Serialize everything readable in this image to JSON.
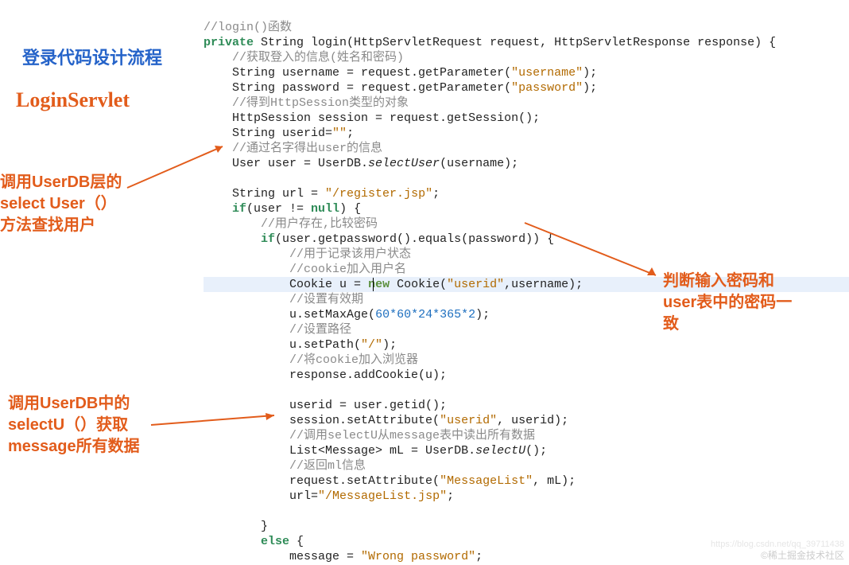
{
  "annotations": {
    "title_blue": "登录代码设计流程",
    "title_orange": "LoginServlet",
    "left1_l1": "调用UserDB层的",
    "left1_l2": "select User（）",
    "left1_l3": "方法查找用户",
    "left2_l1": "调用UserDB中的",
    "left2_l2": "selectU（）获取",
    "left2_l3": "message所有数据",
    "right_l1": "判断输入密码和",
    "right_l2": "user表中的密码一",
    "right_l3": "致"
  },
  "code": {
    "l01a": "//login()函数",
    "l02_kw": "private",
    "l02_rest": " String login(HttpServletRequest request, HttpServletResponse response) {",
    "l03": "//获取登入的信息(姓名和密码)",
    "l04a": "String username = request.getParameter(",
    "l04s": "\"username\"",
    "l04b": ");",
    "l05a": "String password = request.getParameter(",
    "l05s": "\"password\"",
    "l05b": ");",
    "l06": "//得到HttpSession类型的对象",
    "l07": "HttpSession session = request.getSession();",
    "l08a": "String userid=",
    "l08s": "\"\"",
    "l08b": ";",
    "l09": "//通过名字得出user的信息",
    "l10a": "User user = UserDB.",
    "l10i": "selectUser",
    "l10b": "(username);",
    "l11_blank": "",
    "l12a": "String url = ",
    "l12s": "\"/register.jsp\"",
    "l12b": ";",
    "l13_if": "if",
    "l13a": "(user != ",
    "l13_null": "null",
    "l13b": ") {",
    "l14": "//用户存在,比较密码",
    "l15_if": "if",
    "l15a": "(user.getpassword().equals(password)) {",
    "l16": "//用于记录该用户状态",
    "l17": "//cookie加入用户名",
    "l18a": "Cookie u = ",
    "l18_new": "new",
    "l18b": " Cookie(",
    "l18s": "\"userid\"",
    "l18c": ",username);",
    "l19": "//设置有效期",
    "l20a": "u.setMaxAge(",
    "l20n": "60*60*24*365*2",
    "l20b": ");",
    "l21": "//设置路径",
    "l22a": "u.setPath(",
    "l22s": "\"/\"",
    "l22b": ");",
    "l23": "//将cookie加入浏览器",
    "l24": "response.addCookie(u);",
    "l25_blank": "",
    "l26": "userid = user.getid();",
    "l27a": "session.setAttribute(",
    "l27s": "\"userid\"",
    "l27b": ", userid);",
    "l28": "//调用selectU从message表中读出所有数据",
    "l29a": "List<Message> mL = UserDB.",
    "l29i": "selectU",
    "l29b": "();",
    "l30": "//返回ml信息",
    "l31a": "request.setAttribute(",
    "l31s": "\"MessageList\"",
    "l31b": ", mL);",
    "l32a": "url=",
    "l32s": "\"/MessageList.jsp\"",
    "l32b": ";",
    "l33_blank": "",
    "l34": "}",
    "l35_else": "else",
    "l35a": " {",
    "l36a": "message = ",
    "l36s": "\"Wrong password\"",
    "l36b": ";"
  },
  "watermark": "©稀土掘金技术社区",
  "watermark2": "https://blog.csdn.net/qq_39711438"
}
